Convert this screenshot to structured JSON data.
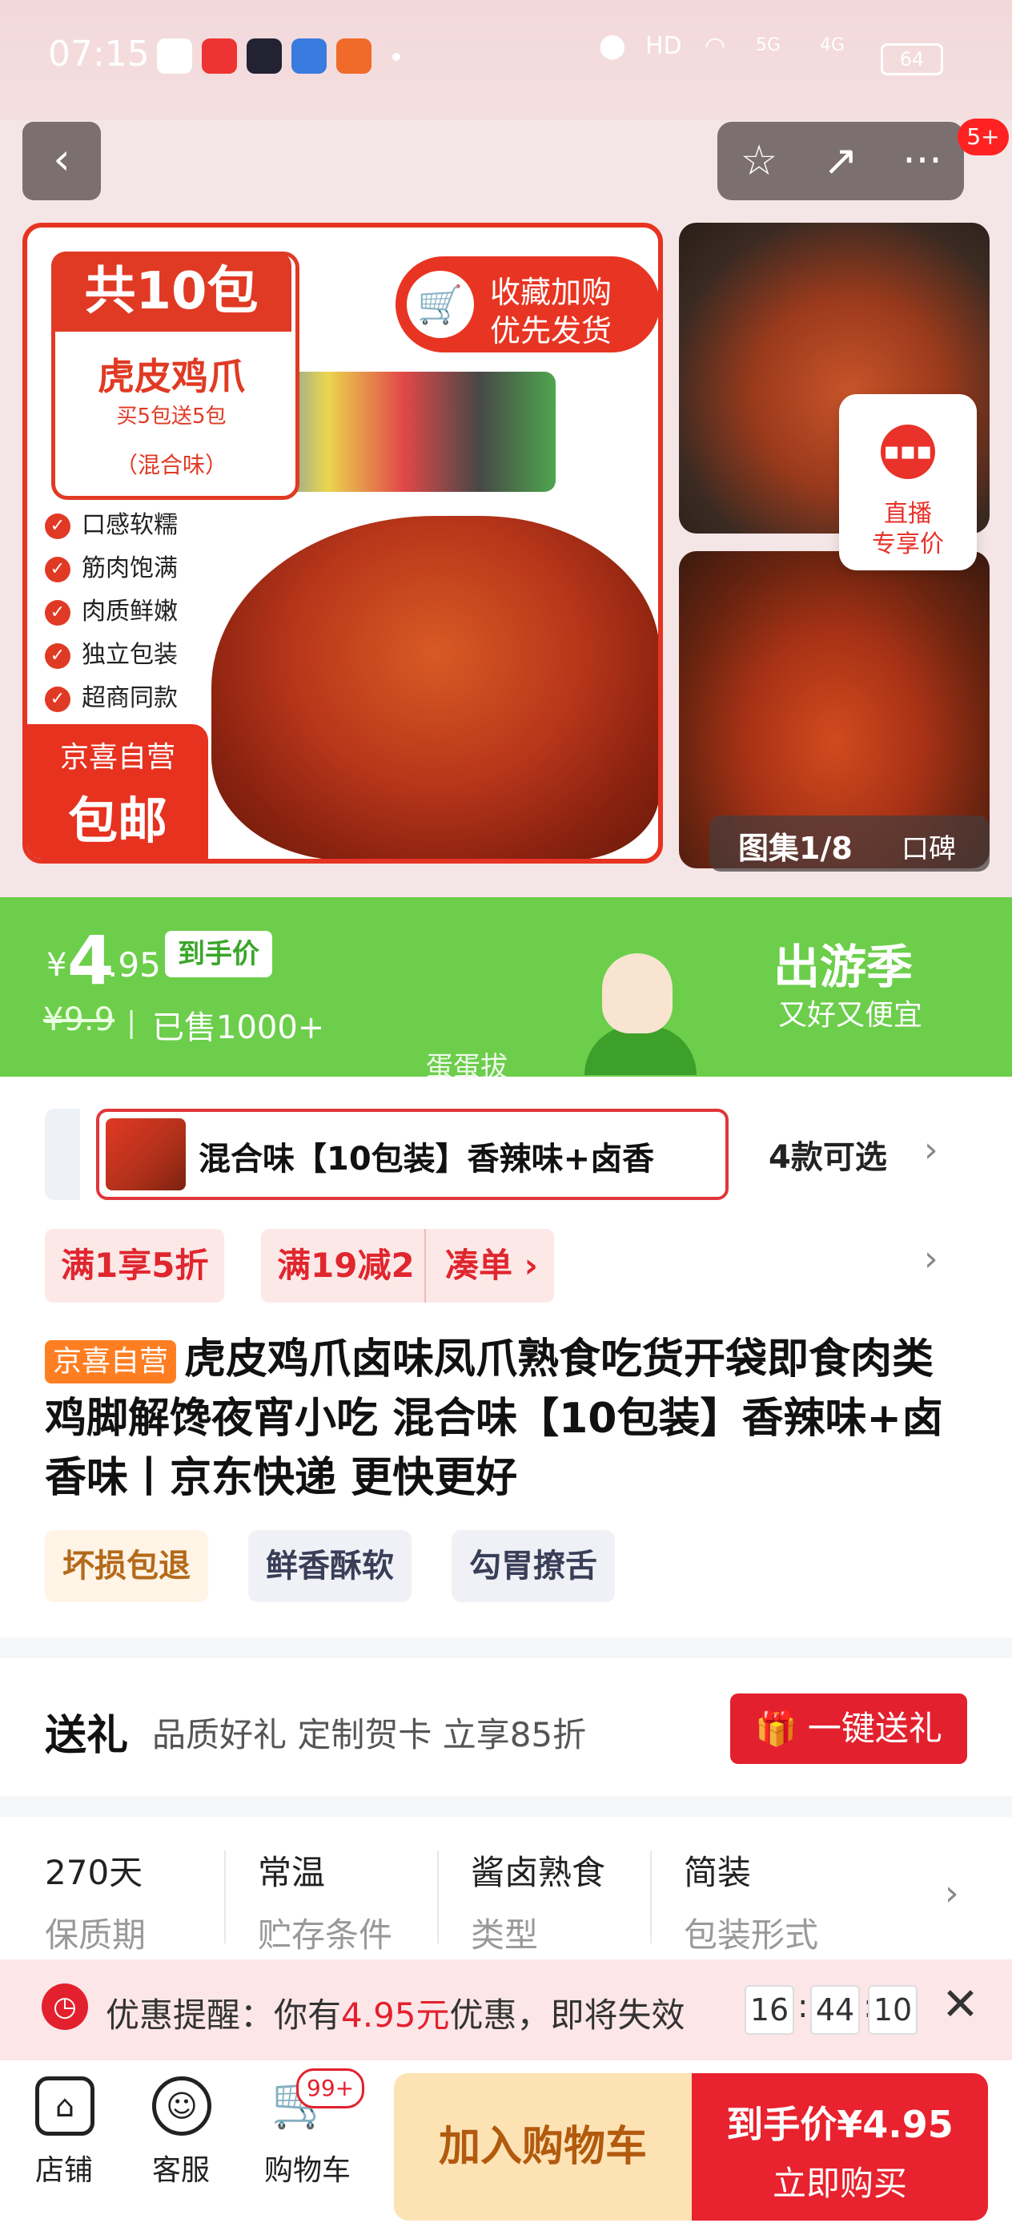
{
  "status_bar": {
    "time": "07:15",
    "signal_5g": "5G",
    "signal_4g": "4G",
    "hd": "HD",
    "battery": "64"
  },
  "header": {
    "back_label": "‹",
    "star_label": "☆",
    "share_label": "↗",
    "more_label": "···",
    "more_badge": "5+"
  },
  "gallery": {
    "pack_title": "共10包",
    "product_name": "虎皮鸡爪",
    "promo_line": "买5包送5包",
    "flavor": "（混合味）",
    "fav_line1": "收藏加购",
    "fav_line2": "优先发货",
    "features": [
      "口感软糯",
      "筋肉饱满",
      "肉质鲜嫩",
      "独立包装",
      "超商同款"
    ],
    "stamp_line1": "京喜自营",
    "stamp_line2": "包邮",
    "live_line1": "直播",
    "live_line2": "专享价",
    "counter": "图集1/8",
    "reviews": "口碑"
  },
  "price": {
    "currency": "¥",
    "integer": "4",
    "decimal": ".95",
    "tag": "到手价",
    "original": "¥9.9",
    "separator": "|",
    "sold": "已售1000+",
    "season_title": "出游季",
    "season_sub": "又好又便宜",
    "watermark": "蛋蛋拔"
  },
  "variants": {
    "selected": "混合味【10包装】香辣味+卤香",
    "count": "4款可选"
  },
  "promos": [
    "满1享5折",
    "满19减2",
    "凑单 ›"
  ],
  "product": {
    "store_badge": "京喜自营",
    "title": "虎皮鸡爪卤味凤爪熟食吃货开袋即食肉类鸡脚解馋夜宵小吃 混合味【10包装】香辣味+卤香味丨京东快递 更快更好",
    "chips": [
      "坏损包退",
      "鲜香酥软",
      "勾胃撩舌"
    ]
  },
  "gift": {
    "title": "送礼",
    "subtitle": "品质好礼 定制贺卡 立享85折",
    "button": "一键送礼"
  },
  "attributes": [
    {
      "value": "270天",
      "label": "保质期"
    },
    {
      "value": "常温",
      "label": "贮存条件"
    },
    {
      "value": "酱卤熟食",
      "label": "类型"
    },
    {
      "value": "简装",
      "label": "包装形式"
    }
  ],
  "reminder": {
    "prefix": "优惠提醒：你有",
    "amount": "4.95元",
    "suffix": "优惠，即将失效",
    "hh": "16",
    "mm": "44",
    "ss": "10"
  },
  "bottom_bar": {
    "store": "店铺",
    "service": "客服",
    "cart": "购物车",
    "cart_badge": "99+",
    "add_to_cart": "加入购物车",
    "buy_price": "到手价¥4.95",
    "buy_label": "立即购买"
  },
  "colors": {
    "accent_red": "#e3212e",
    "price_green": "#6cce4b"
  }
}
